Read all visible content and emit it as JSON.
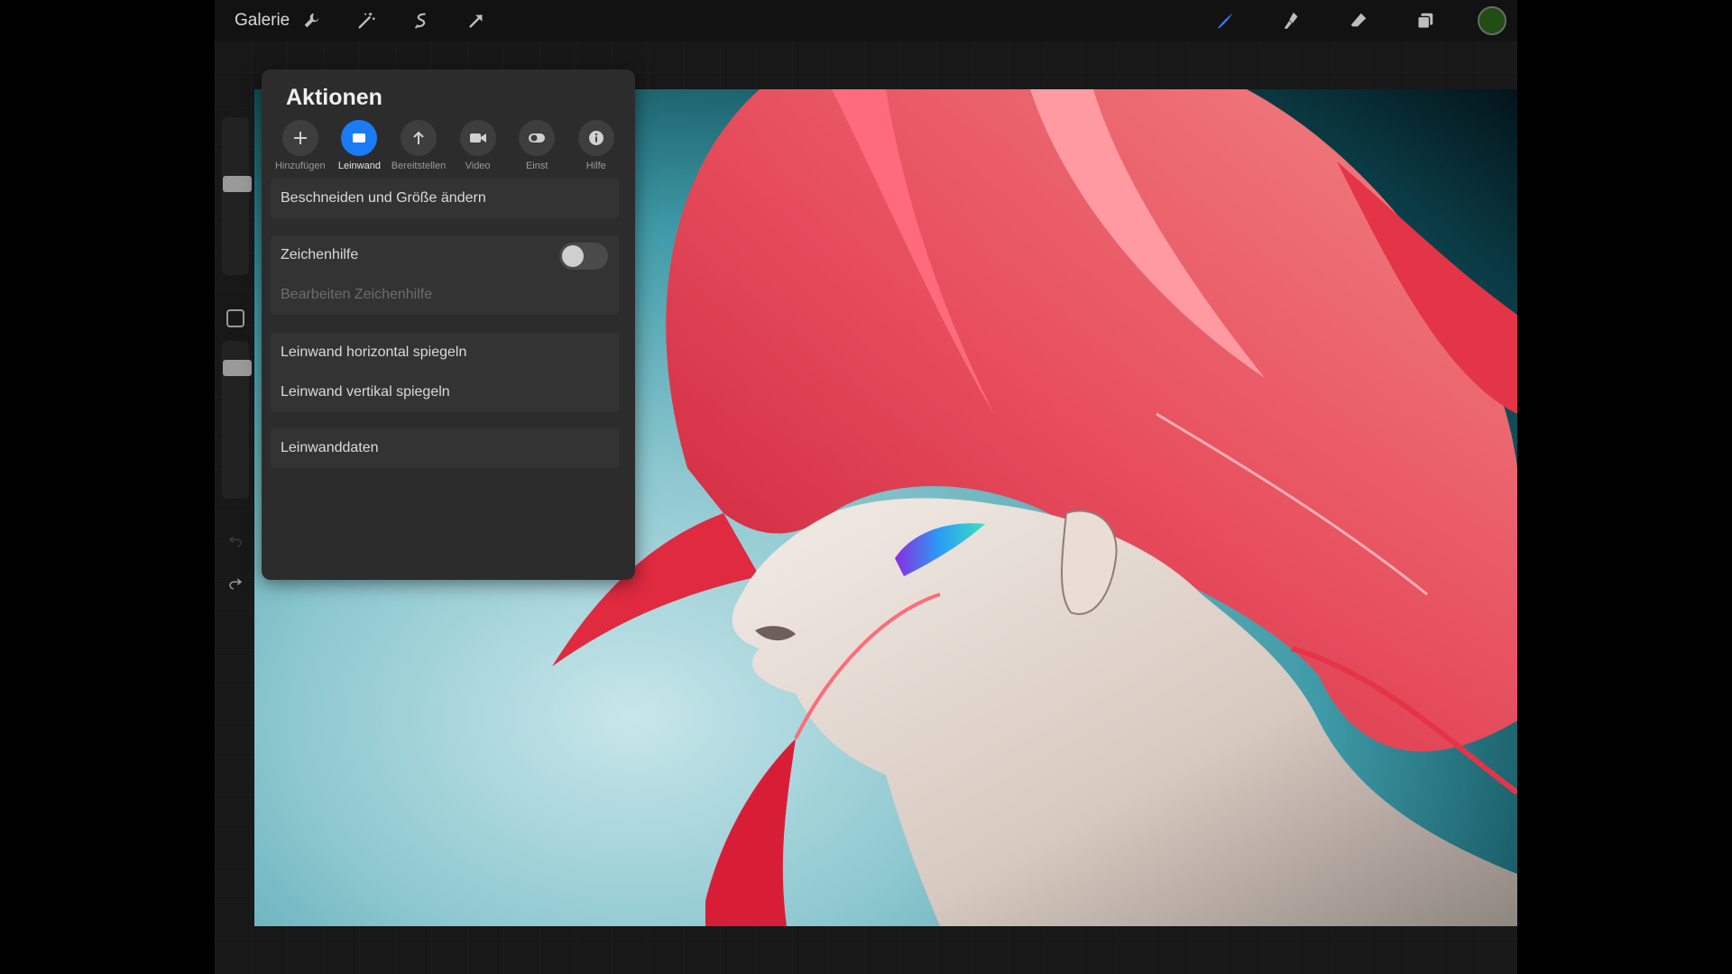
{
  "topbar": {
    "gallery_label": "Galerie",
    "left_icons": [
      "wrench-icon",
      "magic-wand-icon",
      "selection-icon",
      "transform-arrow-icon"
    ],
    "right_icons": [
      "brush-icon",
      "smudge-icon",
      "eraser-icon",
      "layers-icon"
    ],
    "current_color": "#1f4d14"
  },
  "actions": {
    "title": "Aktionen",
    "tabs": [
      {
        "label": "Hinzufügen",
        "icon": "plus-icon"
      },
      {
        "label": "Leinwand",
        "icon": "canvas-icon"
      },
      {
        "label": "Bereitstellen",
        "icon": "share-arrow-icon"
      },
      {
        "label": "Video",
        "icon": "video-camera-icon"
      },
      {
        "label": "Einst",
        "icon": "toggle-icon"
      },
      {
        "label": "Hilfe",
        "icon": "info-icon"
      }
    ],
    "active_tab": "Leinwand",
    "rows": {
      "crop": "Beschneiden und Größe ändern",
      "drawing_guide": "Zeichenhilfe",
      "edit_guide": "Bearbeiten Zeichenhilfe",
      "flip_h": "Leinwand horizontal spiegeln",
      "flip_v": "Leinwand vertikal spiegeln",
      "canvas_info": "Leinwanddaten"
    },
    "drawing_guide_enabled": false
  },
  "accent_color": "#1a7cf5"
}
